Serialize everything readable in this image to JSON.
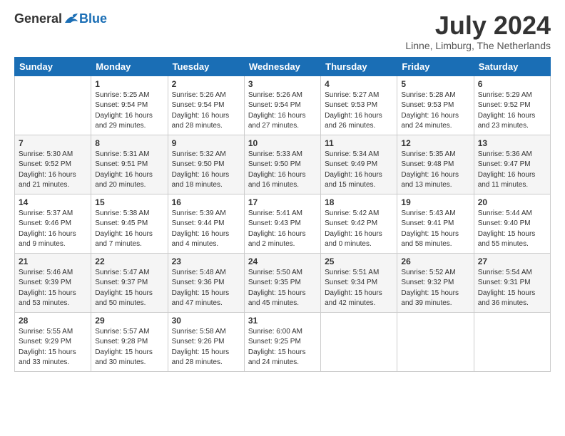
{
  "logo": {
    "general": "General",
    "blue": "Blue"
  },
  "title": "July 2024",
  "location": "Linne, Limburg, The Netherlands",
  "days_of_week": [
    "Sunday",
    "Monday",
    "Tuesday",
    "Wednesday",
    "Thursday",
    "Friday",
    "Saturday"
  ],
  "weeks": [
    [
      {
        "day": "",
        "info": ""
      },
      {
        "day": "1",
        "info": "Sunrise: 5:25 AM\nSunset: 9:54 PM\nDaylight: 16 hours\nand 29 minutes."
      },
      {
        "day": "2",
        "info": "Sunrise: 5:26 AM\nSunset: 9:54 PM\nDaylight: 16 hours\nand 28 minutes."
      },
      {
        "day": "3",
        "info": "Sunrise: 5:26 AM\nSunset: 9:54 PM\nDaylight: 16 hours\nand 27 minutes."
      },
      {
        "day": "4",
        "info": "Sunrise: 5:27 AM\nSunset: 9:53 PM\nDaylight: 16 hours\nand 26 minutes."
      },
      {
        "day": "5",
        "info": "Sunrise: 5:28 AM\nSunset: 9:53 PM\nDaylight: 16 hours\nand 24 minutes."
      },
      {
        "day": "6",
        "info": "Sunrise: 5:29 AM\nSunset: 9:52 PM\nDaylight: 16 hours\nand 23 minutes."
      }
    ],
    [
      {
        "day": "7",
        "info": "Sunrise: 5:30 AM\nSunset: 9:52 PM\nDaylight: 16 hours\nand 21 minutes."
      },
      {
        "day": "8",
        "info": "Sunrise: 5:31 AM\nSunset: 9:51 PM\nDaylight: 16 hours\nand 20 minutes."
      },
      {
        "day": "9",
        "info": "Sunrise: 5:32 AM\nSunset: 9:50 PM\nDaylight: 16 hours\nand 18 minutes."
      },
      {
        "day": "10",
        "info": "Sunrise: 5:33 AM\nSunset: 9:50 PM\nDaylight: 16 hours\nand 16 minutes."
      },
      {
        "day": "11",
        "info": "Sunrise: 5:34 AM\nSunset: 9:49 PM\nDaylight: 16 hours\nand 15 minutes."
      },
      {
        "day": "12",
        "info": "Sunrise: 5:35 AM\nSunset: 9:48 PM\nDaylight: 16 hours\nand 13 minutes."
      },
      {
        "day": "13",
        "info": "Sunrise: 5:36 AM\nSunset: 9:47 PM\nDaylight: 16 hours\nand 11 minutes."
      }
    ],
    [
      {
        "day": "14",
        "info": "Sunrise: 5:37 AM\nSunset: 9:46 PM\nDaylight: 16 hours\nand 9 minutes."
      },
      {
        "day": "15",
        "info": "Sunrise: 5:38 AM\nSunset: 9:45 PM\nDaylight: 16 hours\nand 7 minutes."
      },
      {
        "day": "16",
        "info": "Sunrise: 5:39 AM\nSunset: 9:44 PM\nDaylight: 16 hours\nand 4 minutes."
      },
      {
        "day": "17",
        "info": "Sunrise: 5:41 AM\nSunset: 9:43 PM\nDaylight: 16 hours\nand 2 minutes."
      },
      {
        "day": "18",
        "info": "Sunrise: 5:42 AM\nSunset: 9:42 PM\nDaylight: 16 hours\nand 0 minutes."
      },
      {
        "day": "19",
        "info": "Sunrise: 5:43 AM\nSunset: 9:41 PM\nDaylight: 15 hours\nand 58 minutes."
      },
      {
        "day": "20",
        "info": "Sunrise: 5:44 AM\nSunset: 9:40 PM\nDaylight: 15 hours\nand 55 minutes."
      }
    ],
    [
      {
        "day": "21",
        "info": "Sunrise: 5:46 AM\nSunset: 9:39 PM\nDaylight: 15 hours\nand 53 minutes."
      },
      {
        "day": "22",
        "info": "Sunrise: 5:47 AM\nSunset: 9:37 PM\nDaylight: 15 hours\nand 50 minutes."
      },
      {
        "day": "23",
        "info": "Sunrise: 5:48 AM\nSunset: 9:36 PM\nDaylight: 15 hours\nand 47 minutes."
      },
      {
        "day": "24",
        "info": "Sunrise: 5:50 AM\nSunset: 9:35 PM\nDaylight: 15 hours\nand 45 minutes."
      },
      {
        "day": "25",
        "info": "Sunrise: 5:51 AM\nSunset: 9:34 PM\nDaylight: 15 hours\nand 42 minutes."
      },
      {
        "day": "26",
        "info": "Sunrise: 5:52 AM\nSunset: 9:32 PM\nDaylight: 15 hours\nand 39 minutes."
      },
      {
        "day": "27",
        "info": "Sunrise: 5:54 AM\nSunset: 9:31 PM\nDaylight: 15 hours\nand 36 minutes."
      }
    ],
    [
      {
        "day": "28",
        "info": "Sunrise: 5:55 AM\nSunset: 9:29 PM\nDaylight: 15 hours\nand 33 minutes."
      },
      {
        "day": "29",
        "info": "Sunrise: 5:57 AM\nSunset: 9:28 PM\nDaylight: 15 hours\nand 30 minutes."
      },
      {
        "day": "30",
        "info": "Sunrise: 5:58 AM\nSunset: 9:26 PM\nDaylight: 15 hours\nand 28 minutes."
      },
      {
        "day": "31",
        "info": "Sunrise: 6:00 AM\nSunset: 9:25 PM\nDaylight: 15 hours\nand 24 minutes."
      },
      {
        "day": "",
        "info": ""
      },
      {
        "day": "",
        "info": ""
      },
      {
        "day": "",
        "info": ""
      }
    ]
  ]
}
